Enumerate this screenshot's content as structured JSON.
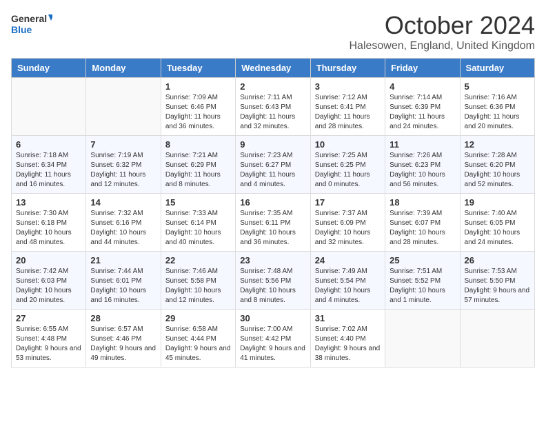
{
  "logo": {
    "general": "General",
    "blue": "Blue"
  },
  "title": "October 2024",
  "subtitle": "Halesowen, England, United Kingdom",
  "days_of_week": [
    "Sunday",
    "Monday",
    "Tuesday",
    "Wednesday",
    "Thursday",
    "Friday",
    "Saturday"
  ],
  "weeks": [
    [
      {
        "day": "",
        "info": ""
      },
      {
        "day": "",
        "info": ""
      },
      {
        "day": "1",
        "info": "Sunrise: 7:09 AM\nSunset: 6:46 PM\nDaylight: 11 hours and 36 minutes."
      },
      {
        "day": "2",
        "info": "Sunrise: 7:11 AM\nSunset: 6:43 PM\nDaylight: 11 hours and 32 minutes."
      },
      {
        "day": "3",
        "info": "Sunrise: 7:12 AM\nSunset: 6:41 PM\nDaylight: 11 hours and 28 minutes."
      },
      {
        "day": "4",
        "info": "Sunrise: 7:14 AM\nSunset: 6:39 PM\nDaylight: 11 hours and 24 minutes."
      },
      {
        "day": "5",
        "info": "Sunrise: 7:16 AM\nSunset: 6:36 PM\nDaylight: 11 hours and 20 minutes."
      }
    ],
    [
      {
        "day": "6",
        "info": "Sunrise: 7:18 AM\nSunset: 6:34 PM\nDaylight: 11 hours and 16 minutes."
      },
      {
        "day": "7",
        "info": "Sunrise: 7:19 AM\nSunset: 6:32 PM\nDaylight: 11 hours and 12 minutes."
      },
      {
        "day": "8",
        "info": "Sunrise: 7:21 AM\nSunset: 6:29 PM\nDaylight: 11 hours and 8 minutes."
      },
      {
        "day": "9",
        "info": "Sunrise: 7:23 AM\nSunset: 6:27 PM\nDaylight: 11 hours and 4 minutes."
      },
      {
        "day": "10",
        "info": "Sunrise: 7:25 AM\nSunset: 6:25 PM\nDaylight: 11 hours and 0 minutes."
      },
      {
        "day": "11",
        "info": "Sunrise: 7:26 AM\nSunset: 6:23 PM\nDaylight: 10 hours and 56 minutes."
      },
      {
        "day": "12",
        "info": "Sunrise: 7:28 AM\nSunset: 6:20 PM\nDaylight: 10 hours and 52 minutes."
      }
    ],
    [
      {
        "day": "13",
        "info": "Sunrise: 7:30 AM\nSunset: 6:18 PM\nDaylight: 10 hours and 48 minutes."
      },
      {
        "day": "14",
        "info": "Sunrise: 7:32 AM\nSunset: 6:16 PM\nDaylight: 10 hours and 44 minutes."
      },
      {
        "day": "15",
        "info": "Sunrise: 7:33 AM\nSunset: 6:14 PM\nDaylight: 10 hours and 40 minutes."
      },
      {
        "day": "16",
        "info": "Sunrise: 7:35 AM\nSunset: 6:11 PM\nDaylight: 10 hours and 36 minutes."
      },
      {
        "day": "17",
        "info": "Sunrise: 7:37 AM\nSunset: 6:09 PM\nDaylight: 10 hours and 32 minutes."
      },
      {
        "day": "18",
        "info": "Sunrise: 7:39 AM\nSunset: 6:07 PM\nDaylight: 10 hours and 28 minutes."
      },
      {
        "day": "19",
        "info": "Sunrise: 7:40 AM\nSunset: 6:05 PM\nDaylight: 10 hours and 24 minutes."
      }
    ],
    [
      {
        "day": "20",
        "info": "Sunrise: 7:42 AM\nSunset: 6:03 PM\nDaylight: 10 hours and 20 minutes."
      },
      {
        "day": "21",
        "info": "Sunrise: 7:44 AM\nSunset: 6:01 PM\nDaylight: 10 hours and 16 minutes."
      },
      {
        "day": "22",
        "info": "Sunrise: 7:46 AM\nSunset: 5:58 PM\nDaylight: 10 hours and 12 minutes."
      },
      {
        "day": "23",
        "info": "Sunrise: 7:48 AM\nSunset: 5:56 PM\nDaylight: 10 hours and 8 minutes."
      },
      {
        "day": "24",
        "info": "Sunrise: 7:49 AM\nSunset: 5:54 PM\nDaylight: 10 hours and 4 minutes."
      },
      {
        "day": "25",
        "info": "Sunrise: 7:51 AM\nSunset: 5:52 PM\nDaylight: 10 hours and 1 minute."
      },
      {
        "day": "26",
        "info": "Sunrise: 7:53 AM\nSunset: 5:50 PM\nDaylight: 9 hours and 57 minutes."
      }
    ],
    [
      {
        "day": "27",
        "info": "Sunrise: 6:55 AM\nSunset: 4:48 PM\nDaylight: 9 hours and 53 minutes."
      },
      {
        "day": "28",
        "info": "Sunrise: 6:57 AM\nSunset: 4:46 PM\nDaylight: 9 hours and 49 minutes."
      },
      {
        "day": "29",
        "info": "Sunrise: 6:58 AM\nSunset: 4:44 PM\nDaylight: 9 hours and 45 minutes."
      },
      {
        "day": "30",
        "info": "Sunrise: 7:00 AM\nSunset: 4:42 PM\nDaylight: 9 hours and 41 minutes."
      },
      {
        "day": "31",
        "info": "Sunrise: 7:02 AM\nSunset: 4:40 PM\nDaylight: 9 hours and 38 minutes."
      },
      {
        "day": "",
        "info": ""
      },
      {
        "day": "",
        "info": ""
      }
    ]
  ]
}
